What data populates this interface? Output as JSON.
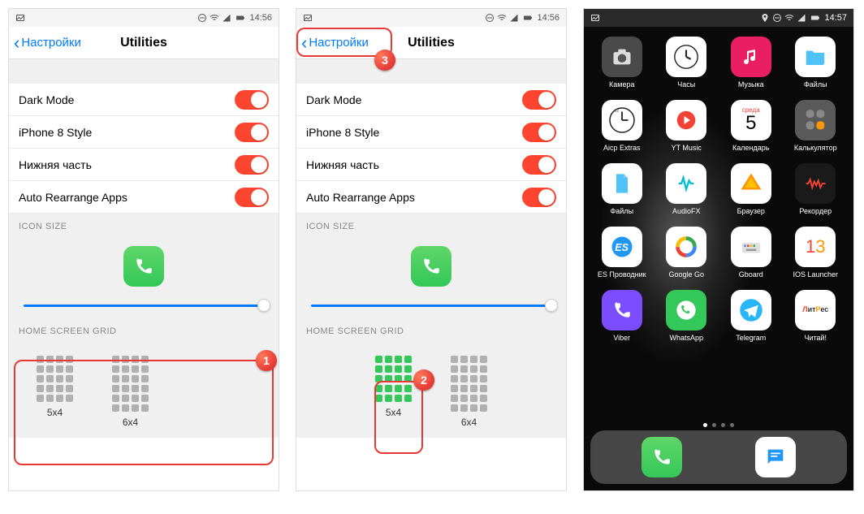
{
  "status": {
    "time1": "14:56",
    "time2": "14:56",
    "time3": "14:57"
  },
  "nav": {
    "back": "Настройки",
    "title": "Utilities"
  },
  "toggles": [
    {
      "label": "Dark Mode",
      "on": true
    },
    {
      "label": "iPhone 8 Style",
      "on": true
    },
    {
      "label": "Нижняя часть",
      "on": true
    },
    {
      "label": "Auto Rearrange Apps",
      "on": true
    }
  ],
  "sections": {
    "iconSize": "ICON SIZE",
    "homeGrid": "HOME SCREEN GRID"
  },
  "grid": {
    "g1": "5x4",
    "g2": "6x4"
  },
  "badges": {
    "b1": "1",
    "b2": "2",
    "b3": "3"
  },
  "home": {
    "apps": [
      {
        "label": "Камера",
        "bg": "#4a4a4a",
        "glyph": "camera"
      },
      {
        "label": "Часы",
        "bg": "#ffffff",
        "glyph": "clock"
      },
      {
        "label": "Музыка",
        "bg": "#e91e63",
        "glyph": "music"
      },
      {
        "label": "Файлы",
        "bg": "#ffffff",
        "glyph": "folder"
      },
      {
        "label": "Aicp Extras",
        "bg": "#ffffff",
        "glyph": "aicp"
      },
      {
        "label": "YT Music",
        "bg": "#ffffff",
        "glyph": "ytm"
      },
      {
        "label": "Календарь",
        "bg": "#ffffff",
        "glyph": "cal"
      },
      {
        "label": "Калькулятор",
        "bg": "#5a5a5a",
        "glyph": "calc"
      },
      {
        "label": "Файлы",
        "bg": "#ffffff",
        "glyph": "files2"
      },
      {
        "label": "AudioFX",
        "bg": "#ffffff",
        "glyph": "afx"
      },
      {
        "label": "Браузер",
        "bg": "#ffffff",
        "glyph": "browser"
      },
      {
        "label": "Рекордер",
        "bg": "#1a1a1a",
        "glyph": "rec"
      },
      {
        "label": "ES Проводник",
        "bg": "#ffffff",
        "glyph": "es"
      },
      {
        "label": "Google Go",
        "bg": "#ffffff",
        "glyph": "ggo"
      },
      {
        "label": "Gboard",
        "bg": "#ffffff",
        "glyph": "gb"
      },
      {
        "label": "IOS Launcher",
        "bg": "#ffffff",
        "glyph": "ios"
      },
      {
        "label": "Viber",
        "bg": "#7c4dff",
        "glyph": "viber"
      },
      {
        "label": "WhatsApp",
        "bg": "#34c759",
        "glyph": "wa"
      },
      {
        "label": "Telegram",
        "bg": "#ffffff",
        "glyph": "tg"
      },
      {
        "label": "Читай!",
        "bg": "#ffffff",
        "glyph": "book"
      }
    ],
    "calendar": {
      "day": "среда",
      "num": "5"
    }
  }
}
